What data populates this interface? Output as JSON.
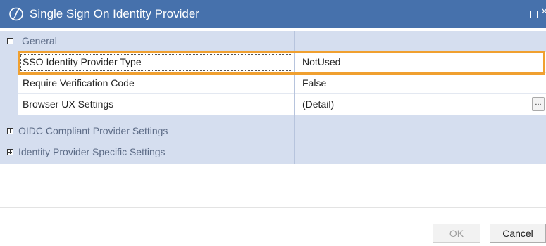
{
  "window": {
    "title": "Single Sign On Identity Provider",
    "maximize_icon": "maximize-icon",
    "close_icon": "close-icon",
    "close_glyph": "×",
    "accent_color": "#4671ac"
  },
  "property_grid": {
    "categories": [
      {
        "label": "General",
        "expanded": true,
        "properties": [
          {
            "name": "SSO Identity Provider Type",
            "value": "NotUsed",
            "selected": true
          },
          {
            "name": "Require Verification Code",
            "value": "False"
          },
          {
            "name": "Browser UX Settings",
            "value": "(Detail)",
            "button": "..."
          }
        ]
      },
      {
        "label": "OIDC Compliant Provider Settings",
        "expanded": false
      },
      {
        "label": "Identity Provider Specific Settings",
        "expanded": false
      }
    ],
    "highlight_color": "#f0a030"
  },
  "footer": {
    "ok_label": "OK",
    "cancel_label": "Cancel"
  }
}
